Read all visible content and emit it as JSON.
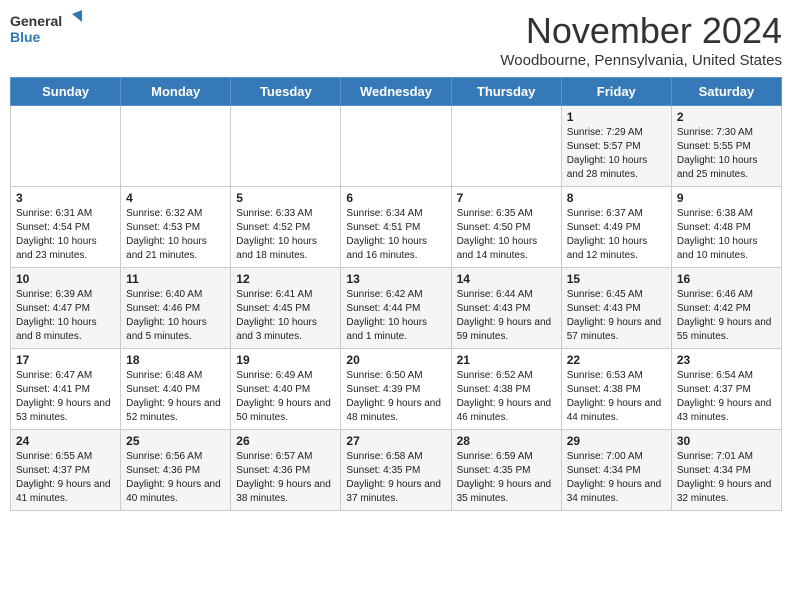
{
  "header": {
    "logo_general": "General",
    "logo_blue": "Blue",
    "month_title": "November 2024",
    "subtitle": "Woodbourne, Pennsylvania, United States"
  },
  "days_of_week": [
    "Sunday",
    "Monday",
    "Tuesday",
    "Wednesday",
    "Thursday",
    "Friday",
    "Saturday"
  ],
  "weeks": [
    [
      {
        "day": "",
        "sunrise": "",
        "sunset": "",
        "daylight": ""
      },
      {
        "day": "",
        "sunrise": "",
        "sunset": "",
        "daylight": ""
      },
      {
        "day": "",
        "sunrise": "",
        "sunset": "",
        "daylight": ""
      },
      {
        "day": "",
        "sunrise": "",
        "sunset": "",
        "daylight": ""
      },
      {
        "day": "",
        "sunrise": "",
        "sunset": "",
        "daylight": ""
      },
      {
        "day": "1",
        "sunrise": "Sunrise: 7:29 AM",
        "sunset": "Sunset: 5:57 PM",
        "daylight": "Daylight: 10 hours and 28 minutes."
      },
      {
        "day": "2",
        "sunrise": "Sunrise: 7:30 AM",
        "sunset": "Sunset: 5:55 PM",
        "daylight": "Daylight: 10 hours and 25 minutes."
      }
    ],
    [
      {
        "day": "3",
        "sunrise": "Sunrise: 6:31 AM",
        "sunset": "Sunset: 4:54 PM",
        "daylight": "Daylight: 10 hours and 23 minutes."
      },
      {
        "day": "4",
        "sunrise": "Sunrise: 6:32 AM",
        "sunset": "Sunset: 4:53 PM",
        "daylight": "Daylight: 10 hours and 21 minutes."
      },
      {
        "day": "5",
        "sunrise": "Sunrise: 6:33 AM",
        "sunset": "Sunset: 4:52 PM",
        "daylight": "Daylight: 10 hours and 18 minutes."
      },
      {
        "day": "6",
        "sunrise": "Sunrise: 6:34 AM",
        "sunset": "Sunset: 4:51 PM",
        "daylight": "Daylight: 10 hours and 16 minutes."
      },
      {
        "day": "7",
        "sunrise": "Sunrise: 6:35 AM",
        "sunset": "Sunset: 4:50 PM",
        "daylight": "Daylight: 10 hours and 14 minutes."
      },
      {
        "day": "8",
        "sunrise": "Sunrise: 6:37 AM",
        "sunset": "Sunset: 4:49 PM",
        "daylight": "Daylight: 10 hours and 12 minutes."
      },
      {
        "day": "9",
        "sunrise": "Sunrise: 6:38 AM",
        "sunset": "Sunset: 4:48 PM",
        "daylight": "Daylight: 10 hours and 10 minutes."
      }
    ],
    [
      {
        "day": "10",
        "sunrise": "Sunrise: 6:39 AM",
        "sunset": "Sunset: 4:47 PM",
        "daylight": "Daylight: 10 hours and 8 minutes."
      },
      {
        "day": "11",
        "sunrise": "Sunrise: 6:40 AM",
        "sunset": "Sunset: 4:46 PM",
        "daylight": "Daylight: 10 hours and 5 minutes."
      },
      {
        "day": "12",
        "sunrise": "Sunrise: 6:41 AM",
        "sunset": "Sunset: 4:45 PM",
        "daylight": "Daylight: 10 hours and 3 minutes."
      },
      {
        "day": "13",
        "sunrise": "Sunrise: 6:42 AM",
        "sunset": "Sunset: 4:44 PM",
        "daylight": "Daylight: 10 hours and 1 minute."
      },
      {
        "day": "14",
        "sunrise": "Sunrise: 6:44 AM",
        "sunset": "Sunset: 4:43 PM",
        "daylight": "Daylight: 9 hours and 59 minutes."
      },
      {
        "day": "15",
        "sunrise": "Sunrise: 6:45 AM",
        "sunset": "Sunset: 4:43 PM",
        "daylight": "Daylight: 9 hours and 57 minutes."
      },
      {
        "day": "16",
        "sunrise": "Sunrise: 6:46 AM",
        "sunset": "Sunset: 4:42 PM",
        "daylight": "Daylight: 9 hours and 55 minutes."
      }
    ],
    [
      {
        "day": "17",
        "sunrise": "Sunrise: 6:47 AM",
        "sunset": "Sunset: 4:41 PM",
        "daylight": "Daylight: 9 hours and 53 minutes."
      },
      {
        "day": "18",
        "sunrise": "Sunrise: 6:48 AM",
        "sunset": "Sunset: 4:40 PM",
        "daylight": "Daylight: 9 hours and 52 minutes."
      },
      {
        "day": "19",
        "sunrise": "Sunrise: 6:49 AM",
        "sunset": "Sunset: 4:40 PM",
        "daylight": "Daylight: 9 hours and 50 minutes."
      },
      {
        "day": "20",
        "sunrise": "Sunrise: 6:50 AM",
        "sunset": "Sunset: 4:39 PM",
        "daylight": "Daylight: 9 hours and 48 minutes."
      },
      {
        "day": "21",
        "sunrise": "Sunrise: 6:52 AM",
        "sunset": "Sunset: 4:38 PM",
        "daylight": "Daylight: 9 hours and 46 minutes."
      },
      {
        "day": "22",
        "sunrise": "Sunrise: 6:53 AM",
        "sunset": "Sunset: 4:38 PM",
        "daylight": "Daylight: 9 hours and 44 minutes."
      },
      {
        "day": "23",
        "sunrise": "Sunrise: 6:54 AM",
        "sunset": "Sunset: 4:37 PM",
        "daylight": "Daylight: 9 hours and 43 minutes."
      }
    ],
    [
      {
        "day": "24",
        "sunrise": "Sunrise: 6:55 AM",
        "sunset": "Sunset: 4:37 PM",
        "daylight": "Daylight: 9 hours and 41 minutes."
      },
      {
        "day": "25",
        "sunrise": "Sunrise: 6:56 AM",
        "sunset": "Sunset: 4:36 PM",
        "daylight": "Daylight: 9 hours and 40 minutes."
      },
      {
        "day": "26",
        "sunrise": "Sunrise: 6:57 AM",
        "sunset": "Sunset: 4:36 PM",
        "daylight": "Daylight: 9 hours and 38 minutes."
      },
      {
        "day": "27",
        "sunrise": "Sunrise: 6:58 AM",
        "sunset": "Sunset: 4:35 PM",
        "daylight": "Daylight: 9 hours and 37 minutes."
      },
      {
        "day": "28",
        "sunrise": "Sunrise: 6:59 AM",
        "sunset": "Sunset: 4:35 PM",
        "daylight": "Daylight: 9 hours and 35 minutes."
      },
      {
        "day": "29",
        "sunrise": "Sunrise: 7:00 AM",
        "sunset": "Sunset: 4:34 PM",
        "daylight": "Daylight: 9 hours and 34 minutes."
      },
      {
        "day": "30",
        "sunrise": "Sunrise: 7:01 AM",
        "sunset": "Sunset: 4:34 PM",
        "daylight": "Daylight: 9 hours and 32 minutes."
      }
    ]
  ]
}
